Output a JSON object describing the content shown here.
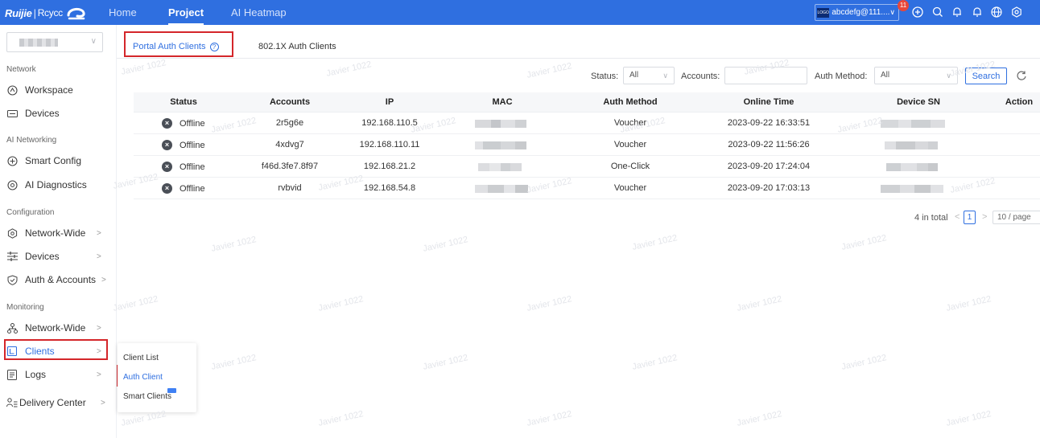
{
  "brand": {
    "name": "Ruijie",
    "separator": "|",
    "sub": "Rcycc"
  },
  "nav": {
    "home": "Home",
    "project": "Project",
    "heatmap": "AI Heatmap"
  },
  "account": {
    "logo_text": "LOGO",
    "name": "abcdefg@111....",
    "chevron": "∨"
  },
  "notifications": {
    "count": "11"
  },
  "sidebar": {
    "chevron": "∨",
    "arrow": ">",
    "sections": {
      "network": "Network",
      "ai": "AI Networking",
      "config": "Configuration",
      "monitoring": "Monitoring"
    },
    "items": {
      "workspace": "Workspace",
      "devices": "Devices",
      "smart_config": "Smart Config",
      "ai_diag": "AI Diagnostics",
      "network_wide": "Network-Wide",
      "config_devices": "Devices",
      "auth_accounts": "Auth & Accounts",
      "mon_network_wide": "Network-Wide",
      "clients": "Clients",
      "logs": "Logs",
      "delivery": "Delivery Center"
    }
  },
  "submenu": {
    "client_list": "Client List",
    "auth_client": "Auth Client",
    "smart_clients": "Smart Clients"
  },
  "tabs": {
    "portal": "Portal Auth Clients",
    "portal_help": "?",
    "dot1x": "802.1X Auth Clients"
  },
  "filters": {
    "status_label": "Status:",
    "status_value": "All",
    "accounts_label": "Accounts:",
    "auth_method_label": "Auth Method:",
    "auth_method_value": "All",
    "search": "Search",
    "chevron": "∨"
  },
  "table": {
    "columns": [
      "Status",
      "Accounts",
      "IP",
      "MAC",
      "Auth Method",
      "Online Time",
      "Device SN",
      "Action"
    ],
    "rows": [
      {
        "status": "Offline",
        "account": "2r5g6e",
        "ip": "192.168.110.5",
        "method": "Voucher",
        "time": "2023-09-22 16:33:51"
      },
      {
        "status": "Offline",
        "account": "4xdvg7",
        "ip": "192.168.110.11",
        "method": "Voucher",
        "time": "2023-09-22 11:56:26"
      },
      {
        "status": "Offline",
        "account": "f46d.3fe7.8f97",
        "ip": "192.168.21.2",
        "method": "One-Click",
        "time": "2023-09-20 17:24:04"
      },
      {
        "status": "Offline",
        "account": "rvbvid",
        "ip": "192.168.54.8",
        "method": "Voucher",
        "time": "2023-09-20 17:03:13"
      }
    ]
  },
  "pagination": {
    "total": "4 in total",
    "prev": "<",
    "page": "1",
    "next": ">",
    "page_size": "10 / page"
  },
  "watermark": "Javier 1022"
}
